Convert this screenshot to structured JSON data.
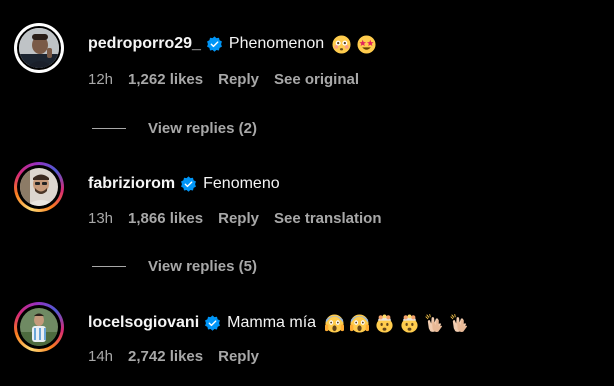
{
  "comments": [
    {
      "username": "pedroporro29_",
      "verified": true,
      "text": "Phenomenon",
      "emojis": [
        "flushed-face-emoji",
        "star-struck-emoji"
      ],
      "time": "12h",
      "likes": "1,262 likes",
      "reply_label": "Reply",
      "extra_label": "See original",
      "view_replies": "View replies (2)"
    },
    {
      "username": "fabriziorom",
      "verified": true,
      "text": "Fenomeno",
      "emojis": [],
      "time": "13h",
      "likes": "1,866 likes",
      "reply_label": "Reply",
      "extra_label": "See translation",
      "view_replies": "View replies (5)"
    },
    {
      "username": "locelsogiovani",
      "verified": true,
      "text": "Mamma mía",
      "emojis": [
        "face-screaming-in-fear-emoji",
        "face-screaming-in-fear-emoji",
        "exploding-head-emoji",
        "exploding-head-emoji",
        "clapping-hands-emoji",
        "clapping-hands-emoji"
      ],
      "time": "14h",
      "likes": "2,742 likes",
      "reply_label": "Reply"
    }
  ],
  "colors": {
    "background": "#000000",
    "primary_text": "#f5f5f5",
    "secondary_text": "#a8a8a8",
    "verified_blue": "#0095f6"
  }
}
